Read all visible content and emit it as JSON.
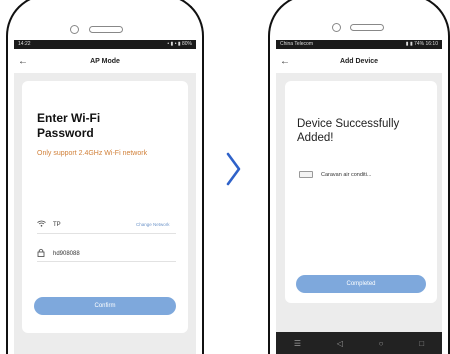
{
  "left_screen": {
    "status_left": "14:22",
    "status_right": "• ▮ • ▮ 80%",
    "nav_title": "AP Mode",
    "heading_line1": "Enter Wi-Fi",
    "heading_line2": "Password",
    "note": "Only support 2.4GHz Wi-Fi network",
    "wifi_ssid": "TP",
    "change_network": "Change Network",
    "password": "hd908088",
    "confirm_label": "Confirm"
  },
  "right_screen": {
    "status_left": "China Telecom",
    "status_right": "▮ ▮ 74% 16:10",
    "nav_title": "Add Device",
    "heading_line1": "Device Successfully",
    "heading_line2": "Added!",
    "device_name": "Caravan air conditi...",
    "completed_label": "Completed"
  },
  "icons": {
    "back": "back-arrow-icon",
    "wifi": "wifi-icon",
    "lock": "lock-icon",
    "device": "air-conditioner-icon",
    "chevron": "chevron-right-icon"
  },
  "colors": {
    "accent": "#7ea8dc",
    "note": "#d1813a",
    "chevron": "#2f62c9"
  }
}
